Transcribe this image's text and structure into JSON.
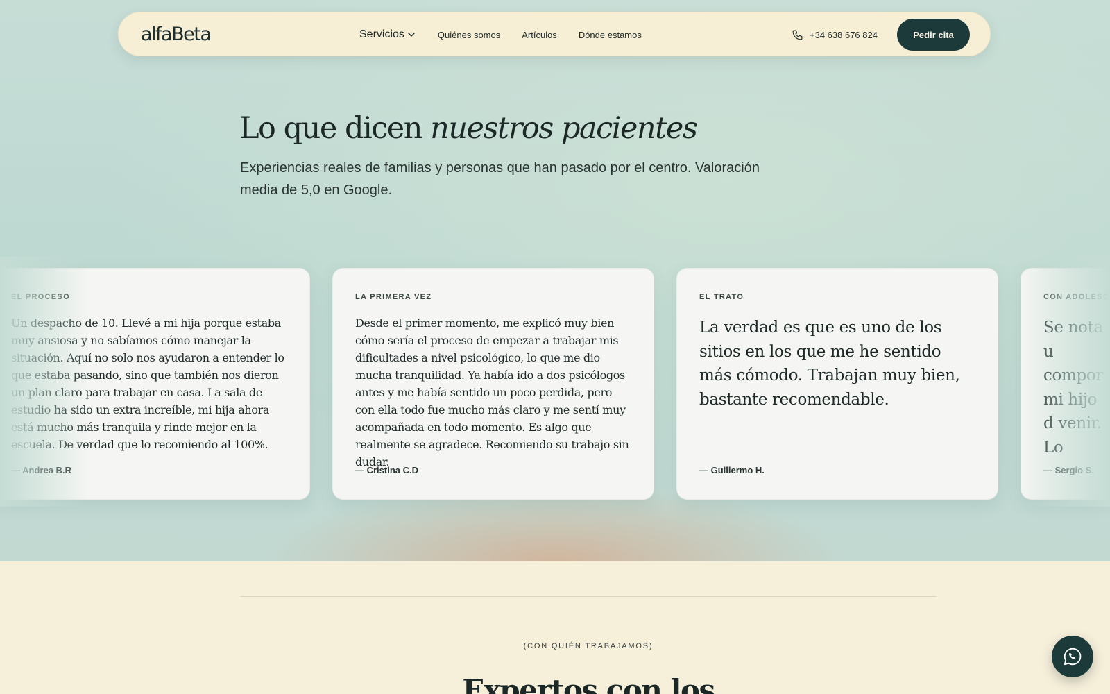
{
  "nav": {
    "logo": "alfaBeta",
    "links": [
      {
        "label": "Servicios"
      },
      {
        "label": "Quiénes somos"
      },
      {
        "label": "Artículos"
      },
      {
        "label": "Dónde estamos"
      }
    ],
    "phone": "+34 638 676 824",
    "cta_label": "Pedir cita"
  },
  "testimonials": {
    "heading_plain": "Lo que dicen ",
    "heading_italic": "nuestros pacientes",
    "subtitle": "Experiencias reales de familias y personas que han pasado por el centro. Valoración media de 5,0 en Google.",
    "cards": [
      {
        "tag": "EL PROCESO",
        "quote": "Un despacho de 10. Llevé a mi hija porque estaba muy ansiosa y no sabíamos cómo manejar la situación. Aquí no solo nos ayudaron a entender lo que estaba pasando, sino que también nos dieron un plan claro para trabajar en casa. La sala de estudio ha sido un extra increíble, mi hija ahora está mucho más tranquila y rinde mejor en la escuela. De verdad que lo recomiendo al 100%.",
        "author": "— Andrea B.R"
      },
      {
        "tag": "LA PRIMERA VEZ",
        "quote": "Desde el primer momento, me explicó muy bien cómo sería el proceso de empezar a trabajar mis dificultades a nivel psicológico, lo que me dio mucha tranquilidad. Ya había ido a dos psicólogos antes y me había sentido un poco perdida, pero con ella todo fue mucho más claro y me sentí muy acompañada en todo momento. Es algo que realmente se agradece. Recomiendo su trabajo sin dudar.",
        "author": "— Cristina C.D"
      },
      {
        "tag": "EL TRATO",
        "quote": "La verdad es que es uno de los sitios en los que me he sentido más cómodo. Trabajan muy bien, bastante recomendable.",
        "author": "— Guillermo H."
      },
      {
        "tag": "CON ADOLESC",
        "quote": "Se nota u compor mi hijo d venir. Lo",
        "author": "— Sergio S."
      }
    ]
  },
  "experts": {
    "eyebrow": "(CON QUIÉN TRABAJAMOS)",
    "title": "Expertos con los"
  },
  "icons": {
    "services_chevron": "chevron-down-icon",
    "phone": "phone-icon",
    "whatsapp": "whatsapp-icon"
  },
  "colors": {
    "accent": "#1d3a3a",
    "page_bg": "#f6efda",
    "band_bg": "#c2dbd4",
    "card_bg": "#f5f6f3"
  }
}
